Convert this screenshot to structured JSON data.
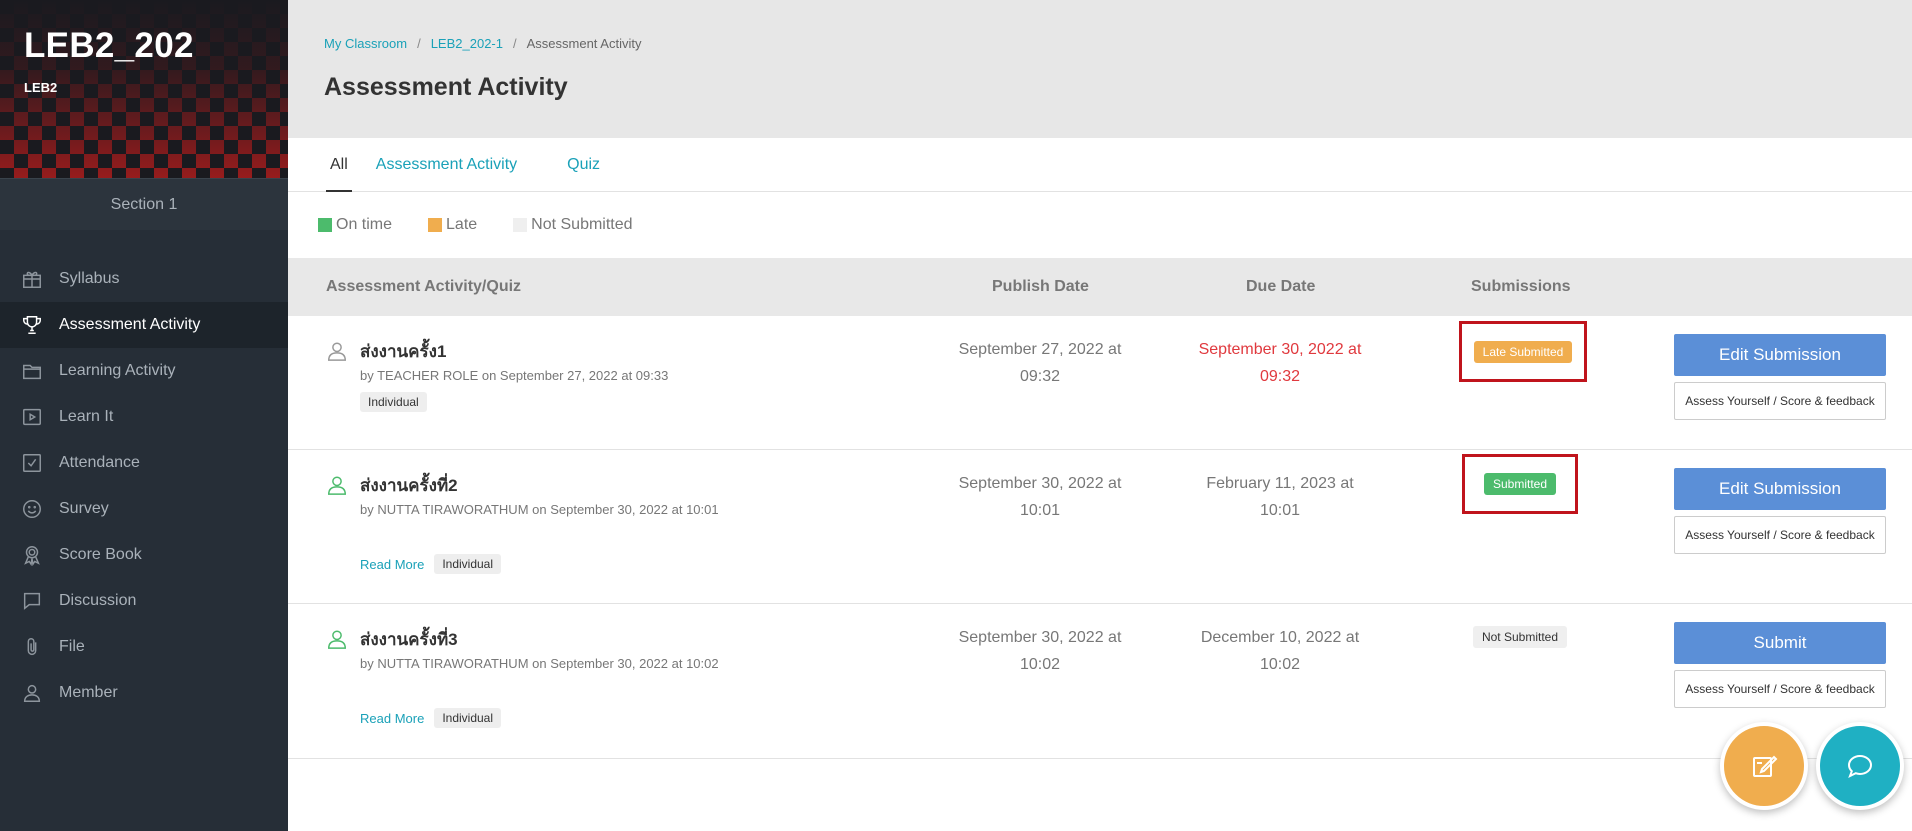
{
  "sidebar": {
    "course_title": "LEB2_202",
    "course_code": "LEB2",
    "section": "Section 1",
    "items": [
      {
        "label": "Syllabus",
        "icon": "gift-icon"
      },
      {
        "label": "Assessment Activity",
        "icon": "trophy-icon"
      },
      {
        "label": "Learning Activity",
        "icon": "folder-icon"
      },
      {
        "label": "Learn It",
        "icon": "play-icon"
      },
      {
        "label": "Attendance",
        "icon": "checkbox-icon"
      },
      {
        "label": "Survey",
        "icon": "smile-icon"
      },
      {
        "label": "Score Book",
        "icon": "award-icon"
      },
      {
        "label": "Discussion",
        "icon": "chat-icon"
      },
      {
        "label": "File",
        "icon": "paperclip-icon"
      },
      {
        "label": "Member",
        "icon": "user-icon"
      }
    ],
    "active_index": 1
  },
  "breadcrumb": {
    "items": [
      "My Classroom",
      "LEB2_202-1",
      "Assessment Activity"
    ],
    "separator": "/"
  },
  "page": {
    "title": "Assessment Activity"
  },
  "tabs": [
    "All",
    "Assessment Activity",
    "Quiz"
  ],
  "legend": [
    {
      "label": "On time",
      "color": "#4cbb6c"
    },
    {
      "label": "Late",
      "color": "#f0ad4e"
    },
    {
      "label": "Not Submitted",
      "color": "#efefef"
    }
  ],
  "table": {
    "headers": [
      "Assessment Activity/Quiz",
      "Publish Date",
      "Due Date",
      "Submissions"
    ],
    "rows": [
      {
        "title": "ส่งงานครั้ง1",
        "by": "by TEACHER ROLE on September 27, 2022 at 09:33",
        "read_more": "",
        "tag": "Individual",
        "publish_line1": "September 27, 2022 at",
        "publish_line2": "09:32",
        "due_line1": "September 30, 2022 at",
        "due_line2": "09:32",
        "status": "Late Submitted",
        "primary_button": "Edit Submission",
        "assess_button": "Assess Yourself / Score & feedback"
      },
      {
        "title": "ส่งงานครั้งที่2",
        "by": "by NUTTA TIRAWORATHUM on September 30, 2022 at 10:01",
        "read_more": "Read More",
        "tag": "Individual",
        "publish_line1": "September 30, 2022 at",
        "publish_line2": "10:01",
        "due_line1": "February 11, 2023 at",
        "due_line2": "10:01",
        "status": "Submitted",
        "primary_button": "Edit Submission",
        "assess_button": "Assess Yourself / Score & feedback"
      },
      {
        "title": "ส่งงานครั้งที่3",
        "by": "by NUTTA TIRAWORATHUM on September 30, 2022 at 10:02",
        "read_more": "Read More",
        "tag": "Individual",
        "publish_line1": "September 30, 2022 at",
        "publish_line2": "10:02",
        "due_line1": "December 10, 2022 at",
        "due_line2": "10:02",
        "status": "Not Submitted",
        "primary_button": "Submit",
        "assess_button": "Assess Yourself / Score & feedback"
      }
    ]
  },
  "colors": {
    "accent_teal": "#1aa1b8",
    "primary_button": "#5b8fd7",
    "late": "#f0ad4e",
    "submitted": "#4cbb6c",
    "overdue_text": "#e0393e",
    "highlight_box": "#c0141c",
    "sidebar_bg": "#262e37"
  },
  "fabs": [
    {
      "icon": "edit-note-icon",
      "color": "#f0ad4e"
    },
    {
      "icon": "chat-bubble-icon",
      "color": "#1fb0c3"
    }
  ]
}
